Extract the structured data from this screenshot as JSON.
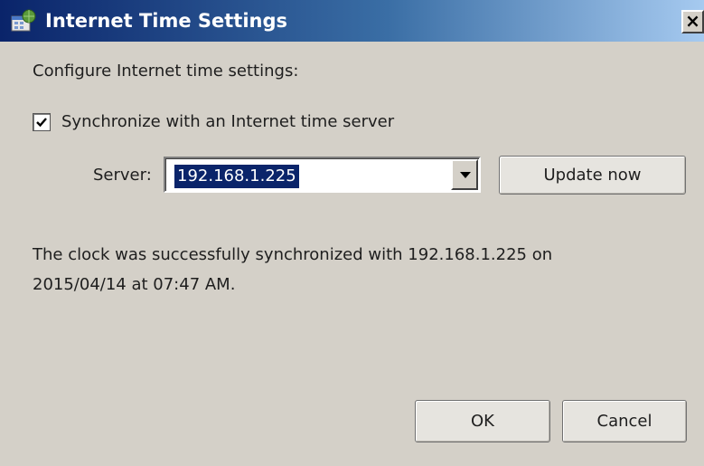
{
  "window": {
    "title": "Internet Time Settings",
    "close_label": "×",
    "title_color": "#0a246a"
  },
  "content": {
    "heading": "Configure Internet time settings:",
    "sync_checkbox": {
      "label": "Synchronize with an Internet time server",
      "checked": true
    },
    "server": {
      "label": "Server:",
      "value": "192.168.1.225"
    },
    "update_button": "Update now",
    "status_line1": "The clock was successfully synchronized with 192.168.1.225 on",
    "status_line2": "2015/04/14 at 07:47 AM."
  },
  "footer": {
    "ok_label": "OK",
    "cancel_label": "Cancel"
  },
  "icons": {
    "app": "clock-globe-icon",
    "close": "close-icon",
    "dropdown": "chevron-down-icon",
    "check": "checkmark-icon"
  }
}
